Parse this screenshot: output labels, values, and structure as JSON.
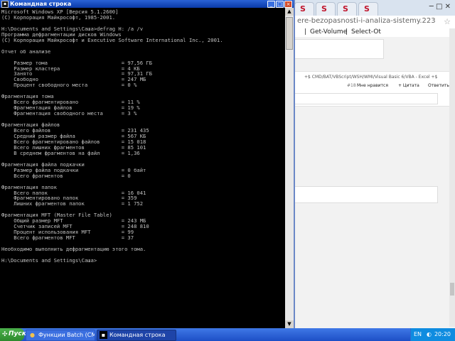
{
  "browser": {
    "tab_icon_letter": "S",
    "url": "ere-bezopasnosti-i-analiza-sistemy.223",
    "crumbs": [
      "|",
      "Get-Volume",
      "|",
      "Select-Ot"
    ],
    "post_path": "+$ CMD/BAT/VBScript/WSH/WMI/Visual Basic 6/VBA - Excel +$",
    "post_num": "#18",
    "post_like": "Мне нравится",
    "post_quote": "+ Цитата",
    "post_reply": "Ответить"
  },
  "cmd": {
    "title": "Командная строка",
    "title_icon": "C:\\",
    "controls": {
      "min": "_",
      "max": "□",
      "close": "×"
    },
    "lines": [
      "Microsoft Windows XP [Версия 5.1.2600]",
      "(С) Корпорация Майкрософт, 1985-2001.",
      "",
      "H:\\Documents and Settings\\Саша>defrag H: /a /v",
      "Программа дефрагментации дисков Windows",
      "(С) Корпорация Майкрософт и Executive Software International Inc., 2001.",
      "",
      "Отчет об анализе",
      "",
      "    Размер тома                        = 97,56 ГБ",
      "    Размер кластера                    = 4 КБ",
      "    Занято                             = 97,31 ГБ",
      "    Свободно                           = 247 МБ",
      "    Процент свободного места           = 0 %",
      "",
      "Фрагментация тома",
      "    Всего фрагментировано              = 11 %",
      "    Фрагментация файлов                = 19 %",
      "    Фрагментация свободного места      = 3 %",
      "",
      "Фрагментация файлов",
      "    Всего файлов                       = 231 435",
      "    Средний размер файла               = 567 КБ",
      "    Всего фрагментировано файлов       = 15 018",
      "    Всего лишних фрагментов            = 85 101",
      "    В среднем фрагментов на файл       = 1,36",
      "",
      "Фрагментация файла подкачки",
      "    Размер файла подкачки              = 0 байт",
      "    Всего фрагментов                   = 0",
      "",
      "Фрагментация папок",
      "    Всего папок                        = 16 041",
      "    Фрагментировано папок              = 359",
      "    Лишних фрагментов папок            = 1 752",
      "",
      "Фрагментация MFT (Master File Table)",
      "    Общий размер MFT                   = 243 МБ",
      "    Счетчик записей MFT                = 248 810",
      "    Процент использования MFT          = 99",
      "    Всего фрагментов MFT               = 37",
      "",
      "Необходимо выполнить дефрагментацию этого тома.",
      "",
      "H:\\Documents and Settings\\Саша>"
    ]
  },
  "taskbar": {
    "start_label": "Пуск",
    "buttons": [
      {
        "label": "Функции Batch (CMD). ..."
      },
      {
        "label": "Командная строка"
      }
    ],
    "clock": "20:20",
    "lang": "EN"
  }
}
